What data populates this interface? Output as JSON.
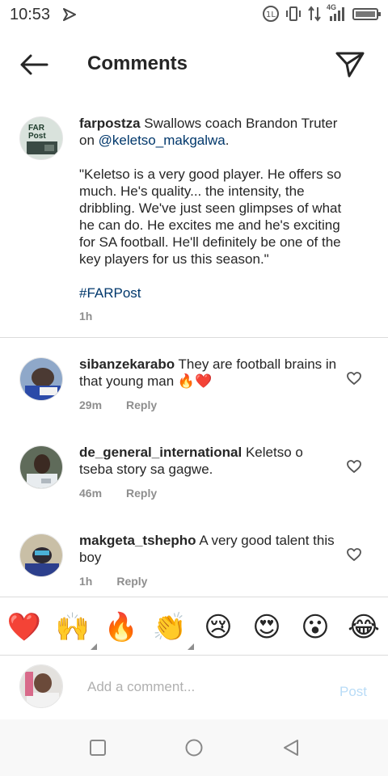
{
  "status": {
    "time": "10:53",
    "network": "4G"
  },
  "header": {
    "title": "Comments"
  },
  "caption": {
    "username": "farpostza",
    "text_pre": " Swallows coach Brandon Truter on ",
    "mention": "@keletso_makgalwa",
    "text_post": ".",
    "quote": "\"Keletso is a very good player. He offers so much. He's quality... the intensity, the dribbling. We've just seen glimpses of what he can do. He excites me and he's exciting for SA football. He'll definitely be one of the key players for us this season.\"",
    "hashtag": "#FARPost",
    "time": "1h",
    "avatar_text": "FAR Post"
  },
  "comments": [
    {
      "username": "sibanzekarabo",
      "text": " They are football brains in that young man 🔥❤️",
      "time": "29m",
      "reply": "Reply"
    },
    {
      "username": "de_general_international",
      "text": " Keletso o tseba story sa gagwe.",
      "time": "46m",
      "reply": "Reply"
    },
    {
      "username": "makgeta_tshepho",
      "text": " A very good talent this boy",
      "time": "1h",
      "reply": "Reply"
    }
  ],
  "reactions": [
    "❤️",
    "🙌",
    "🔥",
    "👏",
    "😢",
    "😍",
    "😮",
    "😂"
  ],
  "add_comment": {
    "placeholder": "Add a comment...",
    "post_label": "Post"
  },
  "colors": {
    "link": "#00376b",
    "muted": "#8e8e8e",
    "post_disabled": "#b9dcf7"
  }
}
